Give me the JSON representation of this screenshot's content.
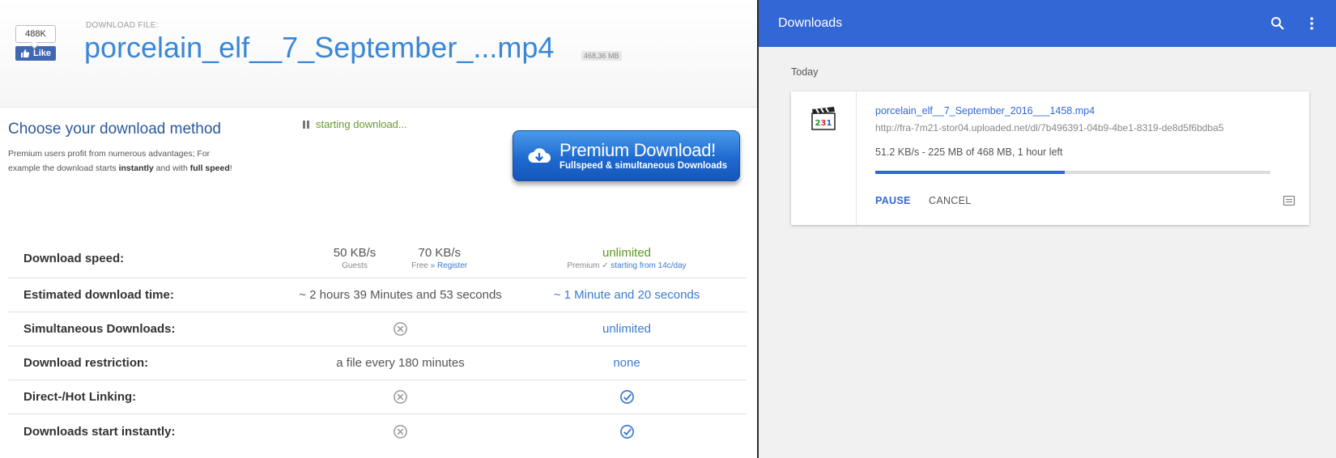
{
  "site": {
    "facebook": {
      "count": "488K",
      "like_label": "Like"
    },
    "download_file_label": "DOWNLOAD FILE:",
    "file_title": "porcelain_elf__7_September_...mp4",
    "file_size": "468,36 MB",
    "method_title": "Choose your download method",
    "method_desc_1": "Premium users profit from numerous advantages; For",
    "method_desc_2a": "example the download starts ",
    "method_desc_2b": "instantly",
    "method_desc_2c": " and with ",
    "method_desc_2d": "full speed",
    "method_desc_2e": "!",
    "status": "starting download...",
    "premium_button": {
      "main": "Premium Download!",
      "sub": "Fullspeed & simultaneous Downloads"
    },
    "comparison": {
      "speed": {
        "label": "Download speed:",
        "guest_value": "50 KB/s",
        "guest_sub": "Guests",
        "free_value": "70 KB/s",
        "free_sub": "Free ",
        "free_sub_link": "» Register",
        "premium_value": "unlimited",
        "premium_sub": "Premium ✓ ",
        "premium_sub_link": "starting from 14c/day"
      },
      "time": {
        "label": "Estimated download time:",
        "free": "~ 2 hours 39 Minutes and 53 seconds",
        "premium": "~ 1 Minute and 20 seconds"
      },
      "simultaneous": {
        "label": "Simultaneous Downloads:",
        "free_icon": "no-icon",
        "premium": "unlimited"
      },
      "restriction": {
        "label": "Download restriction:",
        "free": "a file every 180 minutes",
        "premium": "none"
      },
      "hotlinking": {
        "label": "Direct-/Hot Linking:",
        "free_icon": "no-icon",
        "premium_icon": "check-icon"
      },
      "instant": {
        "label": "Downloads start instantly:",
        "free_icon": "no-icon",
        "premium_icon": "check-icon"
      }
    }
  },
  "downloads_panel": {
    "title": "Downloads",
    "group_label": "Today",
    "item": {
      "icon": "mpc-player-icon",
      "filename": "porcelain_elf__7_September_2016___1458.mp4",
      "url": "http://fra-7m21-stor04.uploaded.net/dl/7b496391-04b9-4be1-8319-de8d5f6bdba5",
      "status": "51.2 KB/s - 225 MB of 468 MB, 1 hour left",
      "progress": 0.48,
      "pause_label": "PAUSE",
      "cancel_label": "CANCEL"
    }
  },
  "colors": {
    "chrome_blue": "#3367d6",
    "site_blue": "#3b87d6",
    "premium_green": "#5a9a1e"
  }
}
